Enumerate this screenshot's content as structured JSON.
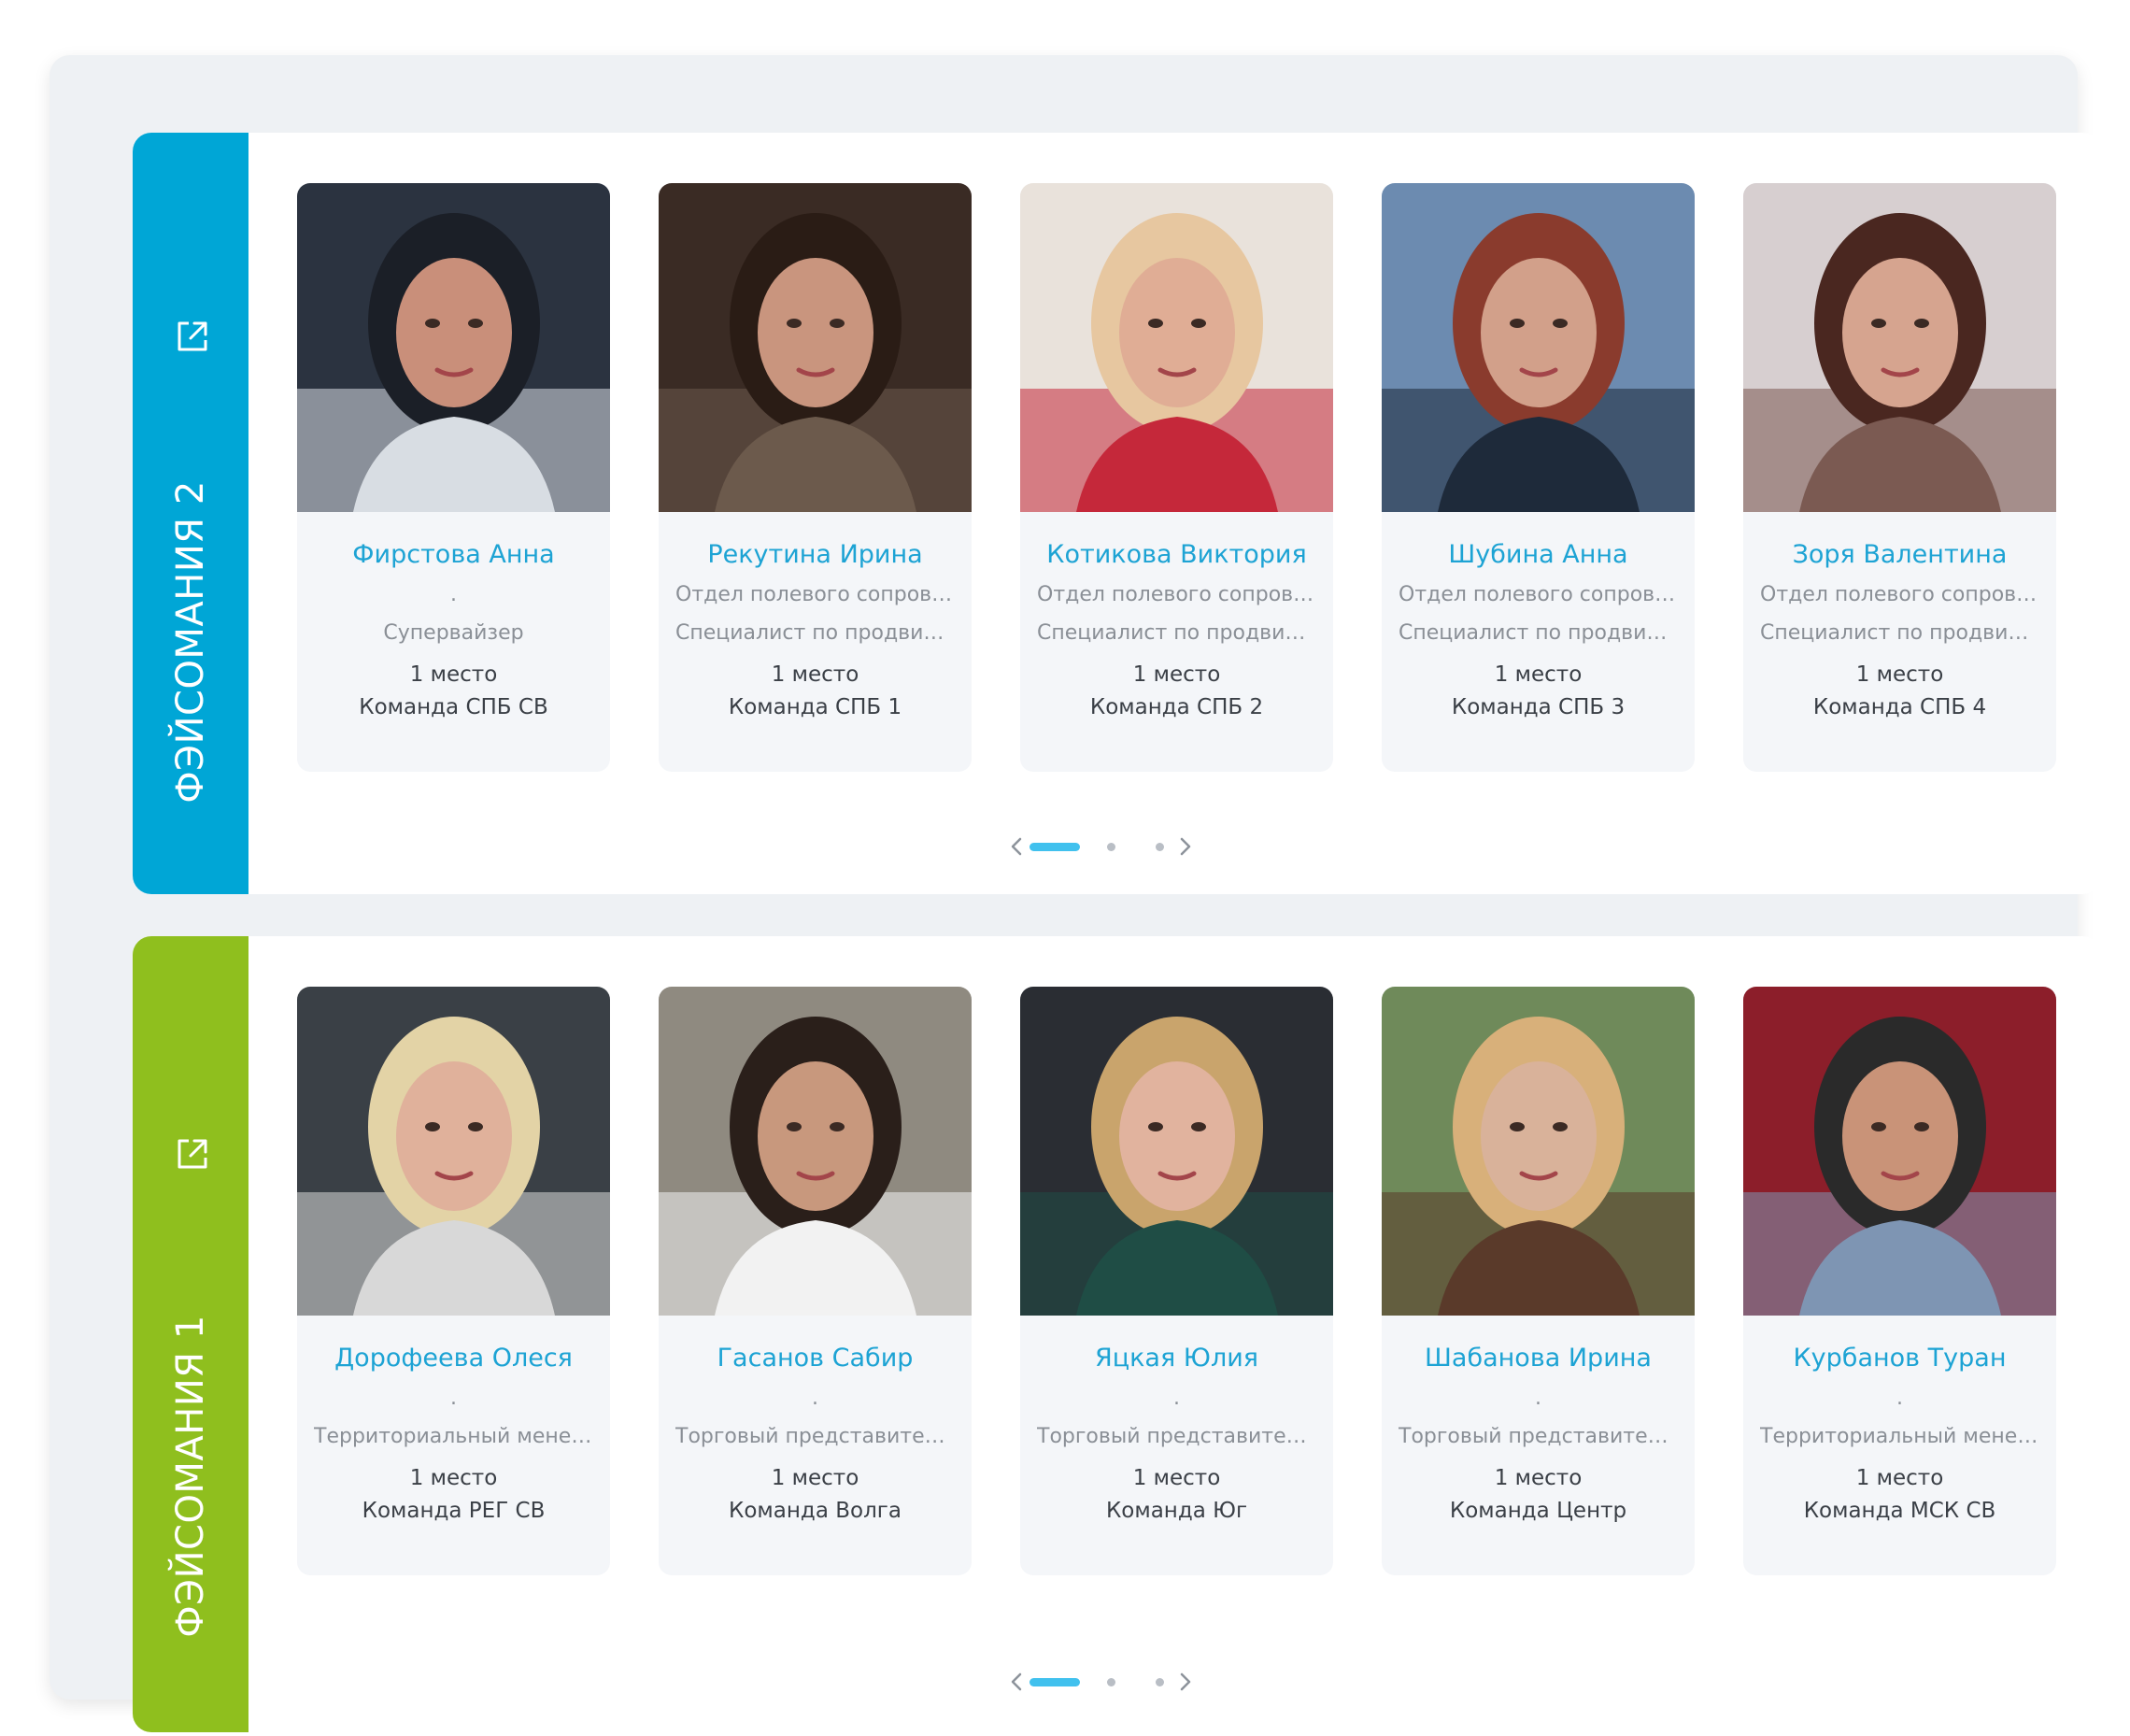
{
  "colors": {
    "panel_0_accent": "#00a6d6",
    "panel_1_accent": "#8fbf1e",
    "name_color": "#1da3d4",
    "active_dot": "#41c1ee"
  },
  "panels": [
    {
      "label": "ФЭЙСОМАНИЯ 2",
      "icon": "external-link-icon",
      "cards": [
        {
          "name": "Фирстова Анна",
          "line1": ".",
          "line2": "Супервайзер",
          "place": "1 место",
          "team": "Команда СПБ СВ",
          "photo": "person-photo"
        },
        {
          "name": "Рекутина Ирина",
          "line1": "Отдел полевого сопровож...",
          "line2": "Специалист по продвиже...",
          "place": "1 место",
          "team": "Команда СПБ 1",
          "photo": "person-photo"
        },
        {
          "name": "Котикова Виктория",
          "line1": "Отдел полевого сопровож...",
          "line2": "Специалист по продвиже...",
          "place": "1 место",
          "team": "Команда СПБ 2",
          "photo": "person-photo"
        },
        {
          "name": "Шубина Анна",
          "line1": "Отдел полевого сопровож...",
          "line2": "Специалист по продвиже...",
          "place": "1 место",
          "team": "Команда СПБ 3",
          "photo": "person-photo"
        },
        {
          "name": "Зоря Валентина",
          "line1": "Отдел полевого сопровож...",
          "line2": "Специалист по продвиже...",
          "place": "1 место",
          "team": "Команда СПБ 4",
          "photo": "person-photo"
        }
      ],
      "pager": {
        "pages": 3,
        "active": 1
      }
    },
    {
      "label": "ФЭЙСОМАНИЯ 1",
      "icon": "external-link-icon",
      "cards": [
        {
          "name": "Дорофеева Олеся",
          "line1": ".",
          "line2": "Территориальный менедж...",
          "place": "1 место",
          "team": "Команда РЕГ СВ",
          "photo": "person-photo"
        },
        {
          "name": "Гасанов Сабир",
          "line1": ".",
          "line2": "Торговый представитель (...",
          "place": "1 место",
          "team": "Команда Волга",
          "photo": "person-photo"
        },
        {
          "name": "Яцкая Юлия",
          "line1": ".",
          "line2": "Торговый представитель (...",
          "place": "1 место",
          "team": "Команда Юг",
          "photo": "person-photo"
        },
        {
          "name": "Шабанова Ирина",
          "line1": ".",
          "line2": "Торговый представитель (...",
          "place": "1 место",
          "team": "Команда Центр",
          "photo": "person-photo"
        },
        {
          "name": "Курбанов Туран",
          "line1": ".",
          "line2": "Территориальный менедж...",
          "place": "1 место",
          "team": "Команда МСК СВ",
          "photo": "person-photo"
        }
      ],
      "pager": {
        "pages": 3,
        "active": 1
      }
    }
  ]
}
